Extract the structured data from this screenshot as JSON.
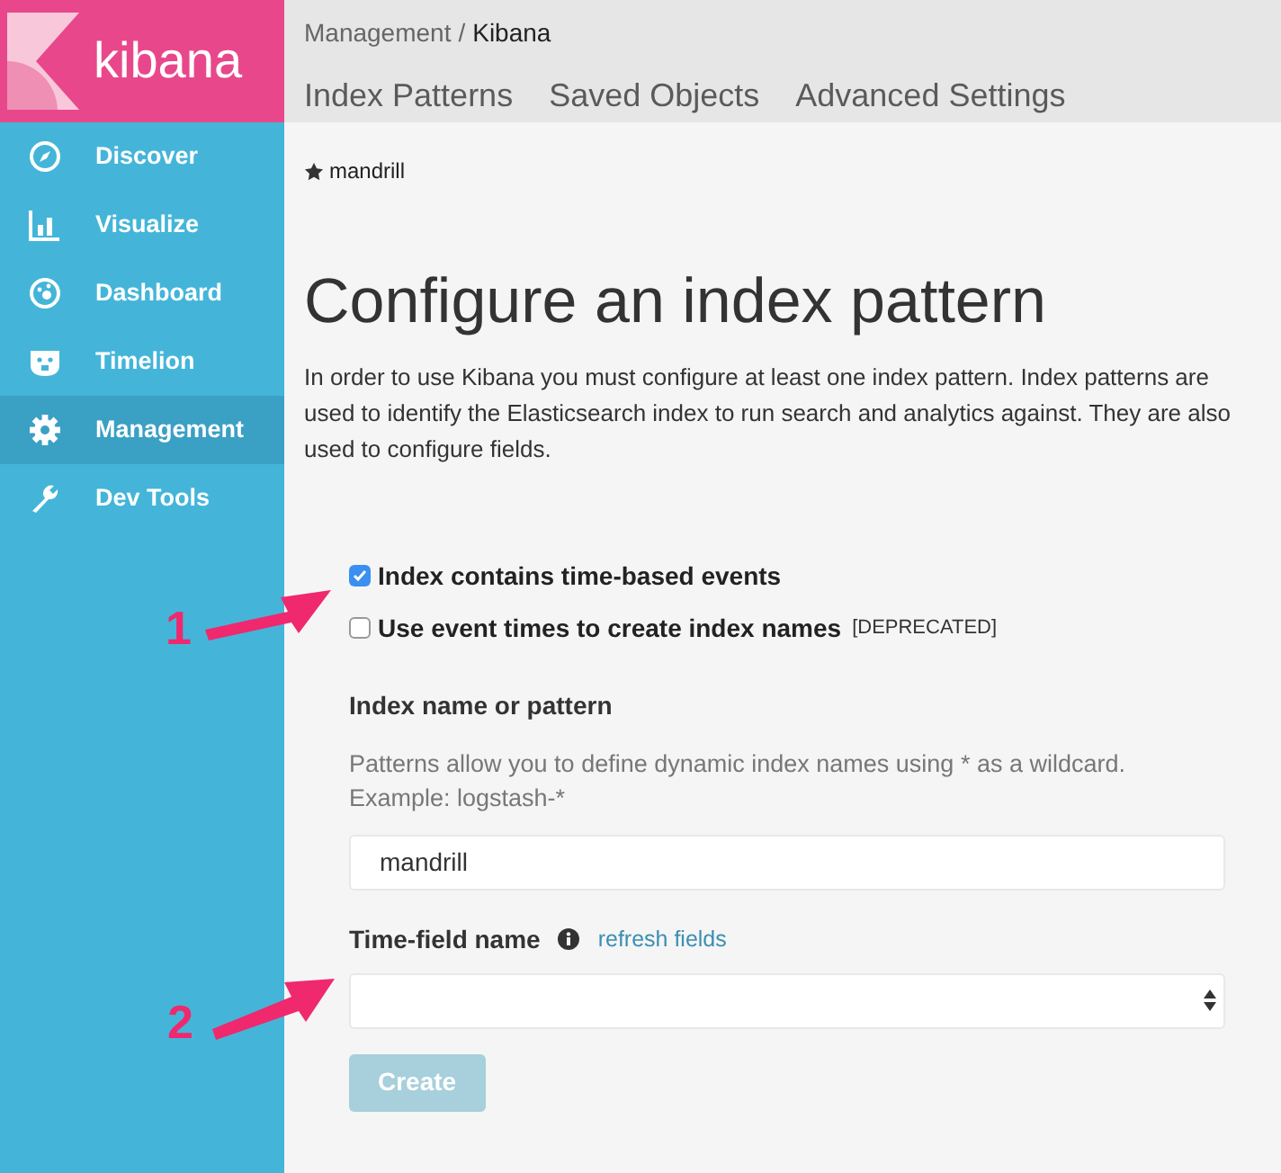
{
  "sidebar": {
    "logo": "kibana",
    "items": [
      {
        "label": "Discover",
        "selected": false
      },
      {
        "label": "Visualize",
        "selected": false
      },
      {
        "label": "Dashboard",
        "selected": false
      },
      {
        "label": "Timelion",
        "selected": false
      },
      {
        "label": "Management",
        "selected": true
      },
      {
        "label": "Dev Tools",
        "selected": false
      }
    ]
  },
  "breadcrumb": [
    "Management",
    "/",
    "Kibana"
  ],
  "tabs": [
    "Index Patterns",
    "Saved Objects",
    "Advanced Settings"
  ],
  "favorite": "mandrill",
  "title": "Configure an index pattern",
  "description": "In order to use Kibana you must configure at least one index pattern. Index patterns are used to identify the Elasticsearch index to run search and analytics against. They are also used to configure fields.",
  "options": [
    {
      "label": "Index contains time-based events",
      "checked": true
    },
    {
      "label": "Use event times to create index names",
      "tag": "[DEPRECATED]",
      "checked": false
    }
  ],
  "index_field": {
    "label": "Index name or pattern",
    "help": "Patterns allow you to define dynamic index names using * as a wildcard. Example: logstash-*",
    "value": "mandrill"
  },
  "time_field": {
    "label": "Time-field name",
    "link": "refresh fields"
  },
  "create_button": {
    "label": "Create",
    "disabled": true
  },
  "annotations": [
    {
      "label": "1"
    },
    {
      "label": "2"
    }
  ]
}
